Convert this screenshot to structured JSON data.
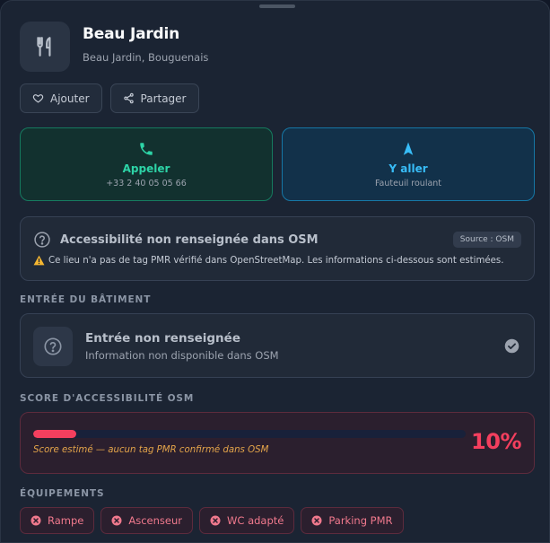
{
  "place": {
    "name": "Beau Jardin",
    "address": "Beau Jardin, Bouguenais",
    "icon": "fork-knife-icon"
  },
  "pills": [
    {
      "label": "Ajouter",
      "icon": "heart-icon"
    },
    {
      "label": "Partager",
      "icon": "share-icon"
    }
  ],
  "actions": {
    "call": {
      "label": "Appeler",
      "sub": "+33 2 40 05 05 66",
      "icon": "phone-icon",
      "color": "#2dd4a7"
    },
    "go": {
      "label": "Y aller",
      "sub": "Fauteuil roulant",
      "icon": "navigation-arrow-icon",
      "color": "#38bdf8"
    }
  },
  "osm": {
    "title": "Accessibilité non renseignée dans OSM",
    "source": "Source : OSM",
    "note": "Ce lieu n'a pas de tag PMR vérifié dans OpenStreetMap. Les informations ci-dessous sont estimées."
  },
  "entrance": {
    "section": "ENTRÉE DU BÂTIMENT",
    "title": "Entrée non renseignée",
    "sub": "Information non disponible dans OSM"
  },
  "score": {
    "section": "SCORE D'ACCESSIBILITÉ OSM",
    "value": "10%",
    "percent": 10,
    "note": "Score estimé — aucun tag PMR confirmé dans OSM",
    "color": "#f43f5e"
  },
  "equipment": {
    "section": "ÉQUIPEMENTS",
    "items": [
      "Rampe",
      "Ascenseur",
      "WC adapté",
      "Parking PMR"
    ]
  }
}
